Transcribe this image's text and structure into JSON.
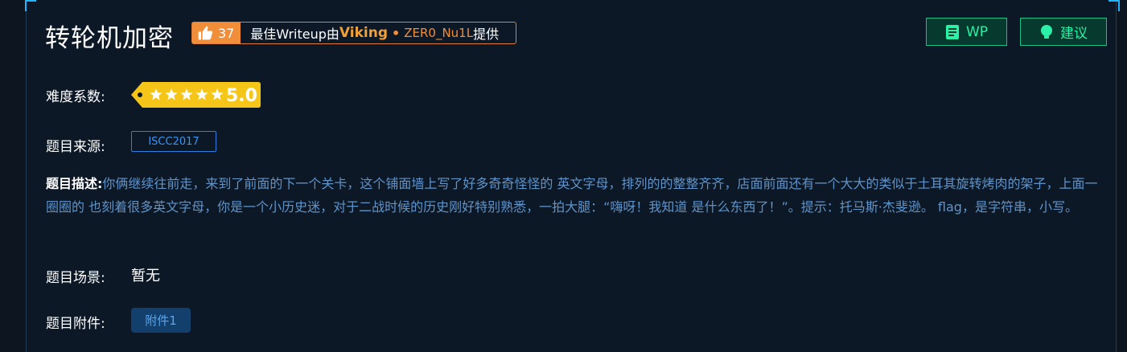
{
  "challenge": {
    "title": "转轮机加密"
  },
  "writeup": {
    "likes": "37",
    "prefix": "最佳Writeup由",
    "user": "Viking",
    "separator": "•",
    "team": "ZER0_Nu1L",
    "suffix": "提供",
    "accent_color": "#f08e3a"
  },
  "actions": {
    "wp_label": "WP",
    "wp_icon": "document-icon",
    "suggest_label": "建议",
    "suggest_icon": "lightbulb-icon",
    "accent_color": "#17c08a"
  },
  "difficulty": {
    "label": "难度系数:",
    "stars": 5,
    "max_stars": 5,
    "score": "5.0",
    "badge_color": "#f5c518"
  },
  "source": {
    "label": "题目来源:",
    "tag": "ISCC2017"
  },
  "description": {
    "label": "题目描述:",
    "text": "你俩继续往前走，来到了前面的下一个关卡，这个铺面墙上写了好多奇奇怪怪的 英文字母，排列的的整整齐齐，店面前面还有一个大大的类似于土耳其旋转烤肉的架子，上面一圈圈的 也刻着很多英文字母，你是一个小历史迷，对于二战时候的历史刚好特别熟悉，一拍大腿：“嗨呀！我知道 是什么东西了！”。提示：托马斯·杰斐逊。 flag，是字符串，小写。"
  },
  "scene": {
    "label": "题目场景:",
    "value": "暂无"
  },
  "attachments": {
    "label": "题目附件:",
    "items": [
      "附件1"
    ]
  }
}
